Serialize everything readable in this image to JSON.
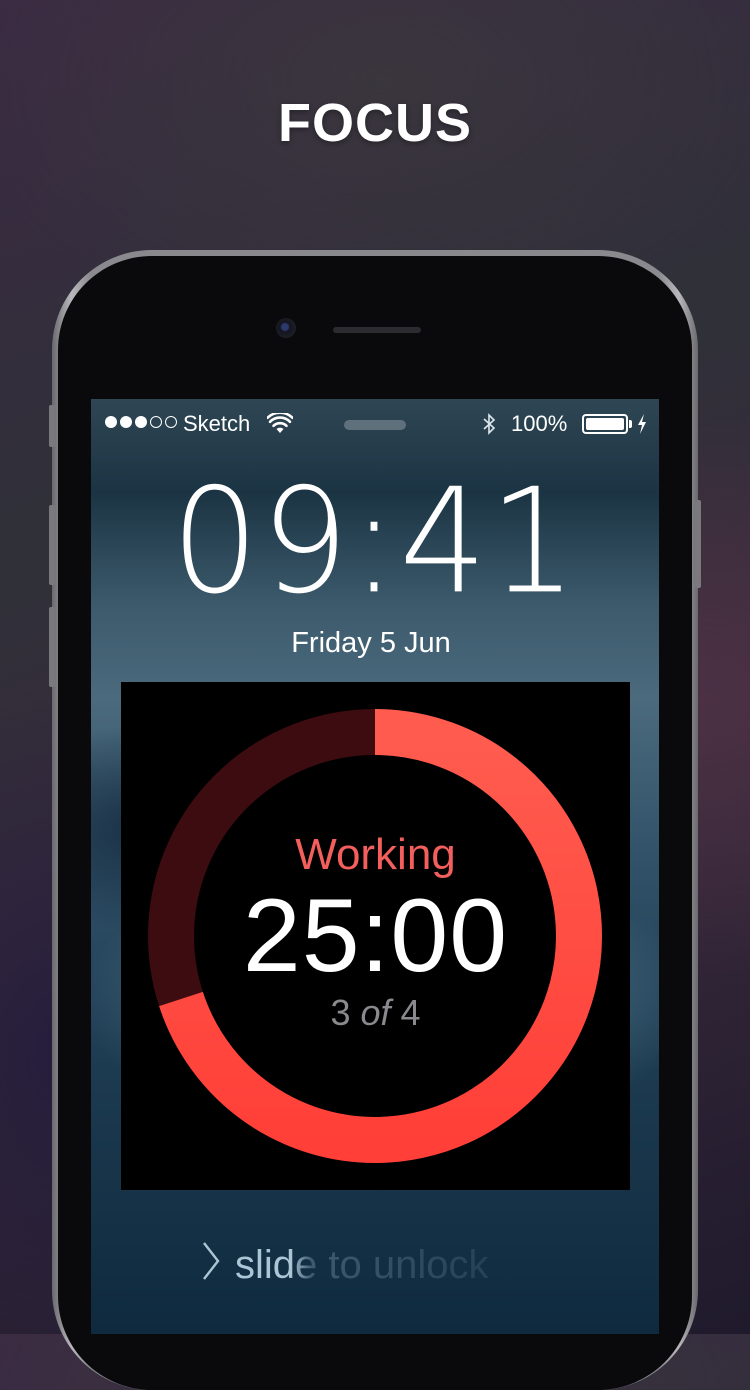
{
  "headline": "FOCUS",
  "status_bar": {
    "carrier": "Sketch",
    "battery_percent": "100%",
    "battery_level": 1.0,
    "signal_bars_filled": 3,
    "signal_bars_total": 5
  },
  "lock_screen": {
    "time": "09:41",
    "date": "Friday 5 Jun",
    "slide_to_unlock": "slide to unlock"
  },
  "timer_widget": {
    "label": "Working",
    "time_remaining": "25:00",
    "session_prefix": "3",
    "session_of": "of",
    "session_total": "4",
    "progress_fraction": 0.7,
    "colors": {
      "accent": "#f25f5c",
      "ring_active": "#ff5a4e",
      "ring_track": "#3d0c10",
      "background": "#000000"
    }
  },
  "icons": [
    "signal-dots-icon",
    "wifi-icon",
    "bluetooth-icon",
    "battery-icon",
    "charging-bolt-icon",
    "chevron-right-icon",
    "front-camera-icon",
    "earpiece-speaker-icon"
  ]
}
